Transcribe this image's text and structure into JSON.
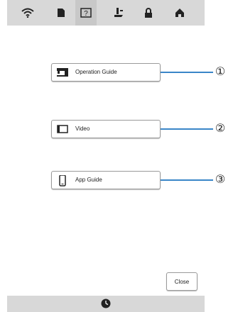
{
  "toolbar": {
    "icons": [
      "wifi-icon",
      "document-icon",
      "help-icon",
      "presser-foot-icon",
      "lock-icon",
      "home-icon"
    ],
    "active": "help-icon"
  },
  "menu": {
    "items": [
      {
        "label": "Operation Guide",
        "icon": "sewing-machine-icon",
        "callout": "①"
      },
      {
        "label": "Video",
        "icon": "video-screen-icon",
        "callout": "②"
      },
      {
        "label": "App Guide",
        "icon": "phone-icon",
        "callout": "③"
      }
    ]
  },
  "close_label": "Close",
  "bottombar": {
    "icon": "clock-icon"
  },
  "colors": {
    "callout_line": "#3a86c8",
    "bar": "#d8d8d8"
  }
}
